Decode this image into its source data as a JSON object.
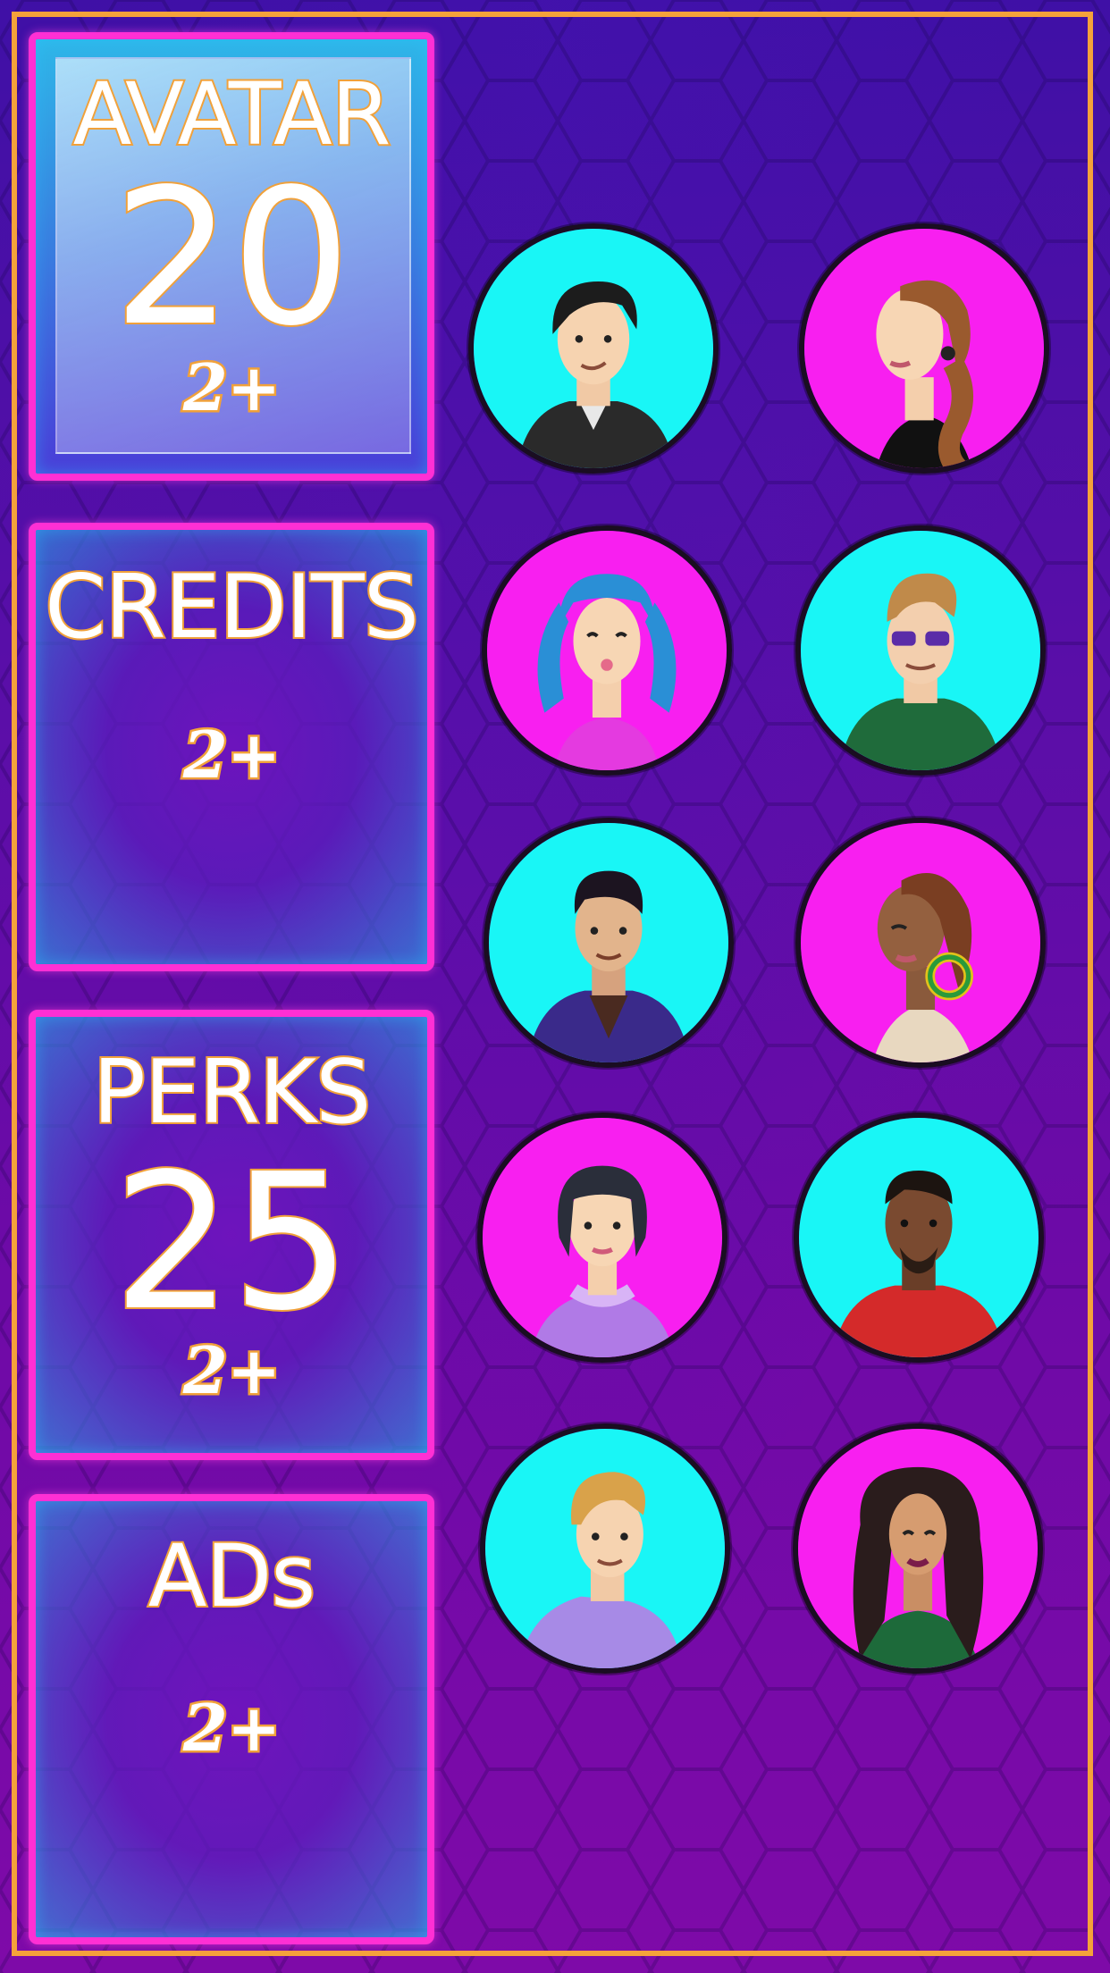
{
  "panels": {
    "avatar": {
      "title": "AVATAR",
      "number": "20",
      "badge": "2+"
    },
    "credits": {
      "title": "CREDITS",
      "badge": "2+"
    },
    "perks": {
      "title": "PERKS",
      "number": "25",
      "badge": "2+"
    },
    "ads": {
      "title": "ADs",
      "badge": "2+"
    }
  },
  "colors": {
    "frame": "#f5a23a",
    "panel_border": "#ff2fd4",
    "cyan": "#19f6f6",
    "magenta": "#f81ff0",
    "text_outline": "#f1a13a"
  },
  "avatars": [
    {
      "name": "dark-hair-man",
      "bg": "cyan"
    },
    {
      "name": "braided-woman",
      "bg": "magenta"
    },
    {
      "name": "blue-pigtails-girl",
      "bg": "magenta"
    },
    {
      "name": "sunglasses-man",
      "bg": "cyan"
    },
    {
      "name": "purple-jacket-man",
      "bg": "cyan"
    },
    {
      "name": "mohawk-woman",
      "bg": "magenta"
    },
    {
      "name": "bob-hair-woman",
      "bg": "magenta"
    },
    {
      "name": "goatee-man",
      "bg": "cyan"
    },
    {
      "name": "blonde-man",
      "bg": "cyan"
    },
    {
      "name": "long-hair-woman",
      "bg": "magenta"
    }
  ]
}
